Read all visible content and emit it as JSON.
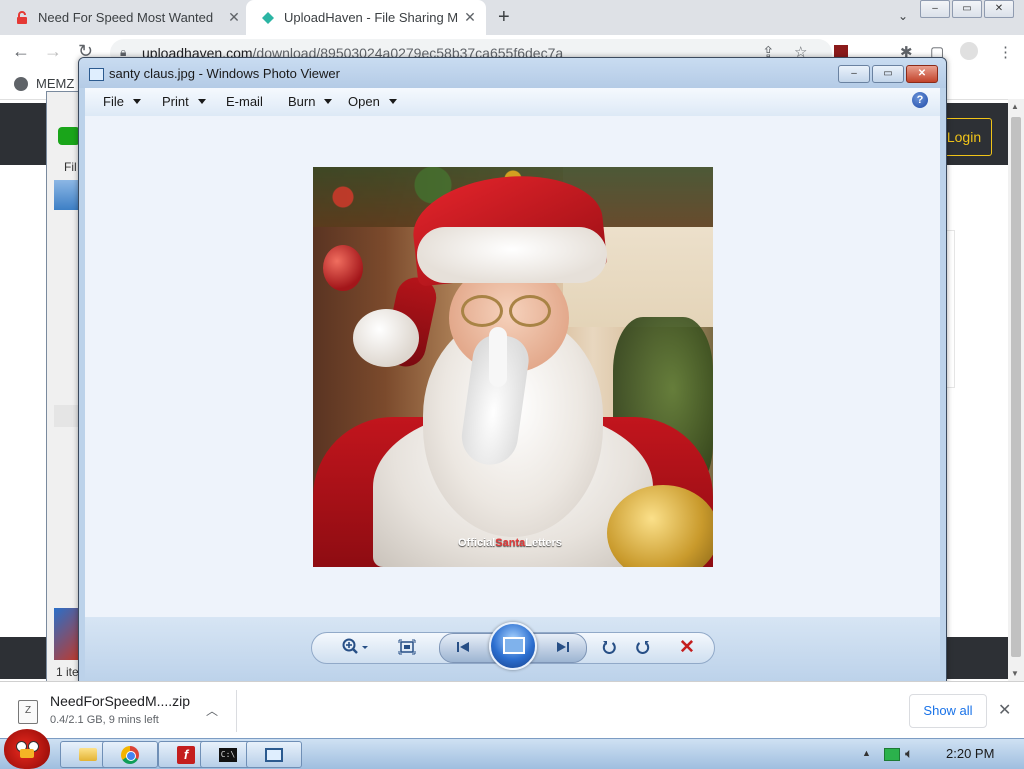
{
  "browser": {
    "tabs": [
      {
        "title": "Need For Speed Most Wanted",
        "active": false,
        "favicon": "lock-red-icon"
      },
      {
        "title": "UploadHaven - File Sharing M",
        "active": true,
        "favicon": "uploadhaven-icon"
      }
    ],
    "new_tab_label": "+",
    "tab_search_label": "⌄",
    "window_buttons": {
      "minimize": "–",
      "maximize": "▭",
      "close": "✕"
    },
    "url_host": "uploadhaven.com",
    "url_path": "/download/89503024a0279ec58b37ca655f6dec7a",
    "bookmark": "MEMZ"
  },
  "site": {
    "login_label": "Login",
    "behind_dialog_fi": "Fil",
    "behind_dialog_items": "1 ite"
  },
  "photo_viewer": {
    "title": "santy claus.jpg - Windows Photo Viewer",
    "menus": [
      "File",
      "Print",
      "E-mail",
      "Burn",
      "Open"
    ],
    "help_label": "?",
    "watermark_a": "Official",
    "watermark_b": "Santa",
    "watermark_c": "Letters"
  },
  "downloads": {
    "file_name": "NeedForSpeedM....zip",
    "status": "0.4/2.1 GB, 9 mins left",
    "show_all": "Show all"
  },
  "taskbar": {
    "clock": "2:20 PM"
  },
  "colors": {
    "accent_login": "#f0c419",
    "site_header": "#2d3035",
    "viewer_frame": "#bcd2ea",
    "delete_red": "#c41e1e"
  }
}
